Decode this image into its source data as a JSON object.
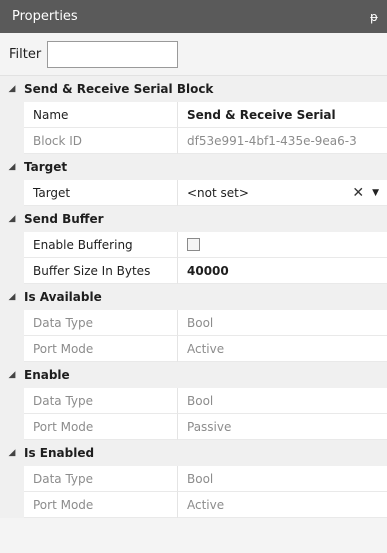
{
  "panel": {
    "title": "Properties",
    "pin_glyph": "ᵽ"
  },
  "filter": {
    "label": "Filter",
    "value": ""
  },
  "categories": [
    {
      "title": "Send & Receive Serial Block",
      "rows": [
        {
          "name": "Name",
          "value": "Send & Receive Serial"
        },
        {
          "name": "Block ID",
          "value": "df53e991-4bf1-435e-9ea6-3"
        }
      ]
    },
    {
      "title": "Target",
      "rows": [
        {
          "name": "Target",
          "value": "<not set>"
        }
      ]
    },
    {
      "title": "Send Buffer",
      "rows": [
        {
          "name": "Enable Buffering",
          "checked": false
        },
        {
          "name": "Buffer Size In Bytes",
          "value": "40000"
        }
      ]
    },
    {
      "title": "Is Available",
      "rows": [
        {
          "name": "Data Type",
          "value": "Bool"
        },
        {
          "name": "Port Mode",
          "value": "Active"
        }
      ]
    },
    {
      "title": "Enable",
      "rows": [
        {
          "name": "Data Type",
          "value": "Bool"
        },
        {
          "name": "Port Mode",
          "value": "Passive"
        }
      ]
    },
    {
      "title": "Is Enabled",
      "rows": [
        {
          "name": "Data Type",
          "value": "Bool"
        },
        {
          "name": "Port Mode",
          "value": "Active"
        }
      ]
    }
  ],
  "icons": {
    "expand": "◢",
    "clear": "✕",
    "dropdown": "▼"
  }
}
